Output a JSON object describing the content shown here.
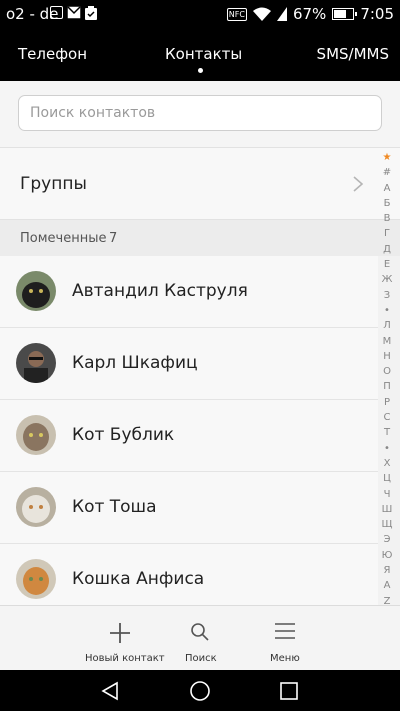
{
  "status_bar": {
    "carrier": "o2 - de",
    "battery": "67%",
    "time": "7:05",
    "nfc_label": "NFC",
    "icons": [
      "image-icon",
      "mail-icon",
      "clipboard-icon",
      "nfc-icon",
      "wifi-icon",
      "signal-icon",
      "battery-icon"
    ]
  },
  "tabs": {
    "phone": "Телефон",
    "contacts": "Контакты",
    "sms": "SMS/MMS",
    "active": "contacts"
  },
  "search": {
    "placeholder": "Поиск контактов"
  },
  "groups": {
    "label": "Группы"
  },
  "favorites": {
    "title": "Помеченные",
    "count": "7"
  },
  "contacts": [
    {
      "name": "Автандил Каструля",
      "avatar": "black-cat"
    },
    {
      "name": "Карл Шкафиц",
      "avatar": "person-dark"
    },
    {
      "name": "Кот Бублик",
      "avatar": "tabby-cat"
    },
    {
      "name": "Кот Тоша",
      "avatar": "white-cat"
    },
    {
      "name": "Кошка Анфиса",
      "avatar": "ginger-cat"
    }
  ],
  "alphabet_index": [
    "★",
    "#",
    "А",
    "Б",
    "В",
    "Г",
    "Д",
    "Е",
    "Ж",
    "З",
    "•",
    "Л",
    "М",
    "Н",
    "О",
    "П",
    "Р",
    "С",
    "Т",
    "•",
    "Х",
    "Ц",
    "Ч",
    "Ш",
    "Щ",
    "Э",
    "Ю",
    "Я",
    "A",
    "Z"
  ],
  "bottom_bar": {
    "new_contact": "Новый контакт",
    "search": "Поиск",
    "menu": "Меню"
  },
  "nav": [
    "back-icon",
    "home-icon",
    "recents-icon"
  ],
  "colors": {
    "accent": "#f08a24",
    "bar": "#000000"
  }
}
